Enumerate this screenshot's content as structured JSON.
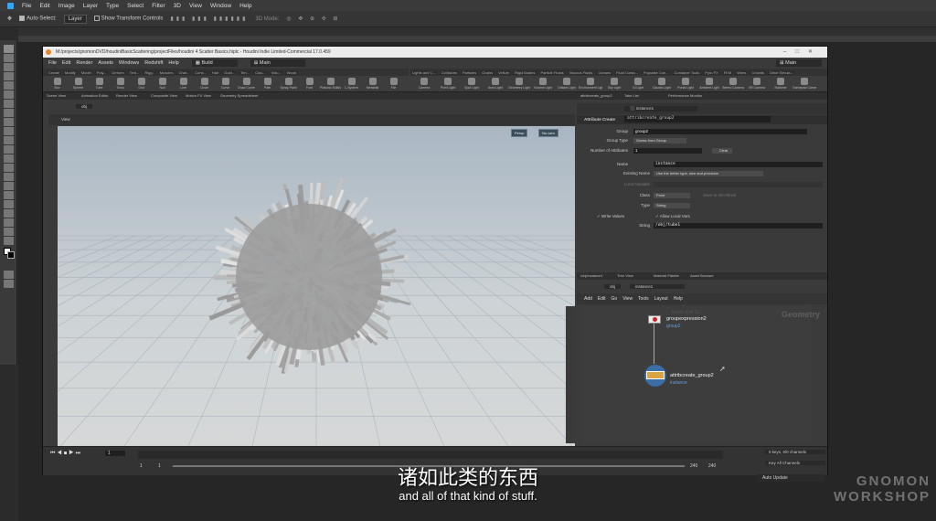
{
  "ps": {
    "menu": [
      "File",
      "Edit",
      "Image",
      "Layer",
      "Type",
      "Select",
      "Filter",
      "3D",
      "View",
      "Window",
      "Help"
    ],
    "options": {
      "auto_select": "Auto-Select:",
      "layer_select": "Layer",
      "transform_controls": "Show Transform Controls",
      "mode_3d": "3D Mode:"
    }
  },
  "houdini": {
    "title": "M:/projects/gnomonDVD/houdiniBasicScattering/projectFiles/houdini 4 Scatter Basics.hiplc - Houdini Indie Limited-Commercial 17.0.459",
    "menu": [
      "File",
      "Edit",
      "Render",
      "Assets",
      "Windows",
      "Redshift",
      "Help"
    ],
    "desktop": "Build",
    "context": "Main",
    "shelf_left_tabs": [
      "Create",
      "Modify",
      "Model",
      "Poly...",
      "Deform",
      "Text...",
      "Rigg..",
      "Muscles",
      "Char...",
      "Cons...",
      "Hair",
      "Guid...",
      "Terr...",
      "Clou...",
      "Volu...",
      "Wood"
    ],
    "shelf_left_icons": [
      "Box",
      "Sphere",
      "Tube",
      "Torus",
      "Grid",
      "Null",
      "Line",
      "Circle",
      "Curve",
      "Draw Curve",
      "Path",
      "Spray Paint",
      "Font",
      "Platonic Solids",
      "L-System",
      "Metaball",
      "File"
    ],
    "shelf_right_tabs": [
      "Lights and C...",
      "Collisions",
      "Particles",
      "Grains",
      "Vellum",
      "Rigid Bodies",
      "Particle Fluids",
      "Viscous Fluids",
      "Oceans",
      "Fluid Conta...",
      "Populate Con...",
      "Container Tools",
      "Pyro FX",
      "FEM",
      "Wires",
      "Crowds",
      "Drive Simula..."
    ],
    "shelf_right_icons": [
      "Camera",
      "Point Light",
      "Spot Light",
      "Area Light",
      "Geometry Light",
      "Volume Light",
      "Distant Light",
      "Environment Light",
      "Sky Light",
      "GI Light",
      "Caustic Light",
      "Portal Light",
      "Ambient Light",
      "Stereo Camera",
      "VR Camera",
      "Switcher",
      "Gamepad Camera"
    ],
    "pane_tabs": [
      "Scene View",
      "Animation Editor",
      "Render View",
      "Composite View",
      "Motion FX View",
      "Geometry Spreadsheet"
    ],
    "viewport": {
      "path": "obj",
      "title": "View",
      "persp": "Persp",
      "cam": "No cam"
    },
    "params": {
      "tabs": [
        "attribcreate_group2",
        "Take List",
        "Performance Monitor"
      ],
      "path": "instance1",
      "node_type": "Attribute Create",
      "node_name": "attribcreate_group2",
      "group_label": "Group",
      "group_value": "group2",
      "group_type_label": "Group Type",
      "group_type_value": "Guess from Group",
      "num_attr_label": "Number of Attributes",
      "num_attr_value": "1",
      "clear": "Clear",
      "name_label": "Name",
      "name_value": "instance",
      "existing_label": "Existing Name",
      "existing_value": "Use the better type, size and precision",
      "local_var_label": "Local Variable",
      "class_label": "Class",
      "class_value": "Point",
      "save_info": "Save to Info Block",
      "type_label": "Type",
      "type_value": "String",
      "write_values": "Write Values",
      "allow_local": "Allow Local Vars",
      "string_label": "String",
      "string_value": "/obj/tube1"
    },
    "network": {
      "tabs": [
        "/obj/instance1",
        "Tree View",
        "Material Palette",
        "Asset Browser"
      ],
      "path": "obj",
      "node": "instance1",
      "menu": [
        "Add",
        "Edit",
        "Go",
        "View",
        "Tools",
        "Layout",
        "Help"
      ],
      "context_label": "Geometry",
      "node1_name": "groupexpression2",
      "node1_sub": "group2",
      "node1_faded": "Inside Edit Sc...",
      "node2_name": "attribcreate_group2",
      "node2_sub": "instance"
    },
    "timeline": {
      "frame": "1",
      "start1": "1",
      "start2": "1",
      "end1": "240",
      "end2": "240",
      "keys": "0 keys, 0/0 channels",
      "key_all": "Key All Channels",
      "auto_update": "Auto Update"
    }
  },
  "subtitle_cn": "诸如此类的东西",
  "subtitle_en": "and all of that kind of stuff.",
  "watermark_line1": "GNOMON",
  "watermark_line2": "WORKSHOP"
}
